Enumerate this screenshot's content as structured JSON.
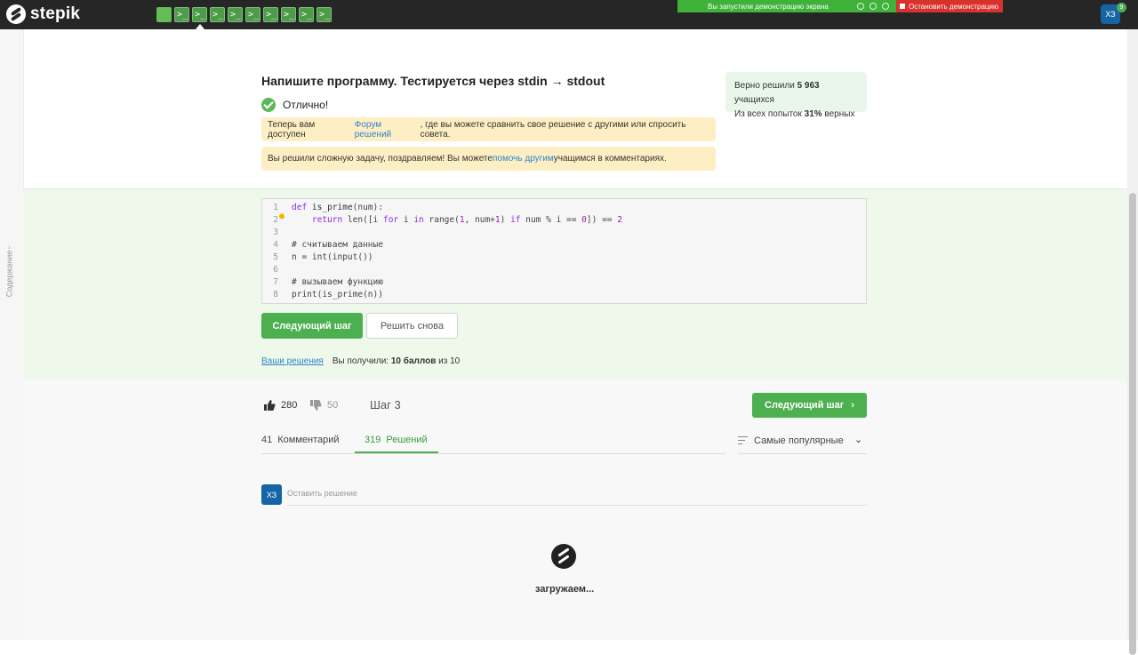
{
  "header": {
    "logo_text": "stepik",
    "steps_glyph": ">_",
    "demo_banner": "Вы запустили демонстрацию экрана",
    "stop_demo": "Остановить демонстрацию",
    "avatar": "ХЗ",
    "notifications": "9"
  },
  "sidebar": {
    "contents_label": "Содержание"
  },
  "task": {
    "title": "Напишите программу. Тестируется через stdin → stdout",
    "status": "Отлично!",
    "note1_before": "Теперь вам доступен ",
    "note1_link": "Форум решений",
    "note1_after": " , где вы можете сравнить свое решение с другими или спросить совета.",
    "note2_before": "Вы решили сложную задачу, поздравляем! Вы можете ",
    "note2_link": "помочь другим",
    "note2_after": " учащимся в комментариях."
  },
  "stats": {
    "solved_prefix": "Верно решили ",
    "solved_count": "5 963",
    "solved_suffix": " учащихся",
    "attempts_prefix": "Из всех попыток ",
    "attempts_percent": "31%",
    "attempts_suffix": " верных"
  },
  "code": {
    "lines": [
      "def is_prime(num):",
      "    return len([i for i in range(1, num+1) if num % i == 0]) == 2",
      "",
      "# считываем данные",
      "n = int(input())",
      "",
      "# вызываем функцию",
      "print(is_prime(n))"
    ],
    "line_numbers": [
      "1",
      "2",
      "3",
      "4",
      "5",
      "6",
      "7",
      "8"
    ]
  },
  "actions": {
    "next_step": "Следующий шаг",
    "solve_again": "Решить снова",
    "your_solutions": "Ваши решения",
    "received_prefix": "Вы получили: ",
    "score": "10 баллов",
    "score_suffix": " из 10"
  },
  "feedback": {
    "likes": "280",
    "dislikes": "50",
    "step_label": "Шаг 3",
    "next_step": "Следующий шаг"
  },
  "tabs": [
    {
      "count": "41",
      "label": "Комментарий"
    },
    {
      "count": "319",
      "label": "Решений"
    }
  ],
  "sort": {
    "label": "Самые популярные"
  },
  "reply": {
    "avatar": "ХЗ",
    "placeholder": "Оставить решение"
  },
  "loading": {
    "text": "загружаем..."
  },
  "colors": {
    "accent": "#4caf50",
    "link": "#3384c8",
    "note_bg": "#fdefc3",
    "topbar": "#262626"
  }
}
